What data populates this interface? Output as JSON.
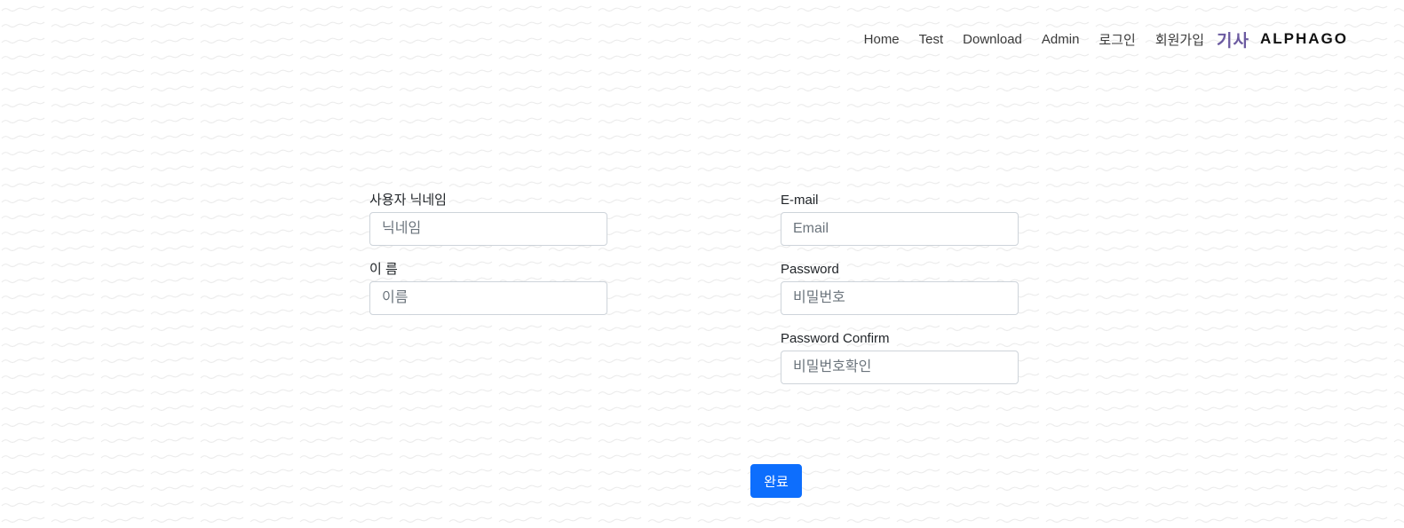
{
  "nav": {
    "items": [
      {
        "label": "Home"
      },
      {
        "label": "Test"
      },
      {
        "label": "Download"
      },
      {
        "label": "Admin"
      },
      {
        "label": "로그인"
      },
      {
        "label": "회원가입"
      }
    ],
    "brand_kr": "기사",
    "brand_en": "ALPHAGO"
  },
  "form": {
    "nickname": {
      "label": "사용자 닉네임",
      "placeholder": "닉네임",
      "value": ""
    },
    "name": {
      "label": "이 름",
      "placeholder": "이름",
      "value": ""
    },
    "email": {
      "label": "E-mail",
      "placeholder": "Email",
      "value": ""
    },
    "password": {
      "label": "Password",
      "placeholder": "비밀번호",
      "value": ""
    },
    "password_confirm": {
      "label": "Password Confirm",
      "placeholder": "비밀번호확인",
      "value": ""
    },
    "submit_label": "완료"
  },
  "colors": {
    "primary": "#0d6efd",
    "brand_accent": "#6b5aa0",
    "input_border": "#ced4da"
  }
}
